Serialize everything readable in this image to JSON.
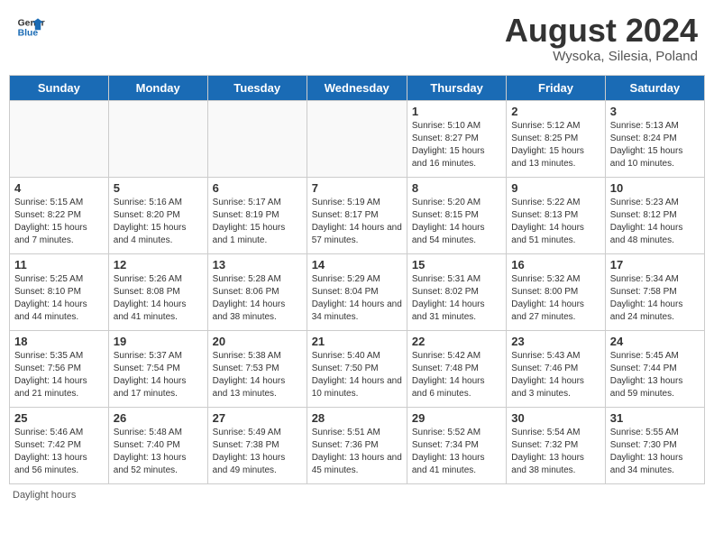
{
  "logo": {
    "line1": "General",
    "line2": "Blue"
  },
  "title": {
    "month_year": "August 2024",
    "location": "Wysoka, Silesia, Poland"
  },
  "days_of_week": [
    "Sunday",
    "Monday",
    "Tuesday",
    "Wednesday",
    "Thursday",
    "Friday",
    "Saturday"
  ],
  "footer": {
    "daylight_label": "Daylight hours"
  },
  "weeks": [
    [
      {
        "day": "",
        "info": ""
      },
      {
        "day": "",
        "info": ""
      },
      {
        "day": "",
        "info": ""
      },
      {
        "day": "",
        "info": ""
      },
      {
        "day": "1",
        "info": "Sunrise: 5:10 AM\nSunset: 8:27 PM\nDaylight: 15 hours and 16 minutes."
      },
      {
        "day": "2",
        "info": "Sunrise: 5:12 AM\nSunset: 8:25 PM\nDaylight: 15 hours and 13 minutes."
      },
      {
        "day": "3",
        "info": "Sunrise: 5:13 AM\nSunset: 8:24 PM\nDaylight: 15 hours and 10 minutes."
      }
    ],
    [
      {
        "day": "4",
        "info": "Sunrise: 5:15 AM\nSunset: 8:22 PM\nDaylight: 15 hours and 7 minutes."
      },
      {
        "day": "5",
        "info": "Sunrise: 5:16 AM\nSunset: 8:20 PM\nDaylight: 15 hours and 4 minutes."
      },
      {
        "day": "6",
        "info": "Sunrise: 5:17 AM\nSunset: 8:19 PM\nDaylight: 15 hours and 1 minute."
      },
      {
        "day": "7",
        "info": "Sunrise: 5:19 AM\nSunset: 8:17 PM\nDaylight: 14 hours and 57 minutes."
      },
      {
        "day": "8",
        "info": "Sunrise: 5:20 AM\nSunset: 8:15 PM\nDaylight: 14 hours and 54 minutes."
      },
      {
        "day": "9",
        "info": "Sunrise: 5:22 AM\nSunset: 8:13 PM\nDaylight: 14 hours and 51 minutes."
      },
      {
        "day": "10",
        "info": "Sunrise: 5:23 AM\nSunset: 8:12 PM\nDaylight: 14 hours and 48 minutes."
      }
    ],
    [
      {
        "day": "11",
        "info": "Sunrise: 5:25 AM\nSunset: 8:10 PM\nDaylight: 14 hours and 44 minutes."
      },
      {
        "day": "12",
        "info": "Sunrise: 5:26 AM\nSunset: 8:08 PM\nDaylight: 14 hours and 41 minutes."
      },
      {
        "day": "13",
        "info": "Sunrise: 5:28 AM\nSunset: 8:06 PM\nDaylight: 14 hours and 38 minutes."
      },
      {
        "day": "14",
        "info": "Sunrise: 5:29 AM\nSunset: 8:04 PM\nDaylight: 14 hours and 34 minutes."
      },
      {
        "day": "15",
        "info": "Sunrise: 5:31 AM\nSunset: 8:02 PM\nDaylight: 14 hours and 31 minutes."
      },
      {
        "day": "16",
        "info": "Sunrise: 5:32 AM\nSunset: 8:00 PM\nDaylight: 14 hours and 27 minutes."
      },
      {
        "day": "17",
        "info": "Sunrise: 5:34 AM\nSunset: 7:58 PM\nDaylight: 14 hours and 24 minutes."
      }
    ],
    [
      {
        "day": "18",
        "info": "Sunrise: 5:35 AM\nSunset: 7:56 PM\nDaylight: 14 hours and 21 minutes."
      },
      {
        "day": "19",
        "info": "Sunrise: 5:37 AM\nSunset: 7:54 PM\nDaylight: 14 hours and 17 minutes."
      },
      {
        "day": "20",
        "info": "Sunrise: 5:38 AM\nSunset: 7:53 PM\nDaylight: 14 hours and 13 minutes."
      },
      {
        "day": "21",
        "info": "Sunrise: 5:40 AM\nSunset: 7:50 PM\nDaylight: 14 hours and 10 minutes."
      },
      {
        "day": "22",
        "info": "Sunrise: 5:42 AM\nSunset: 7:48 PM\nDaylight: 14 hours and 6 minutes."
      },
      {
        "day": "23",
        "info": "Sunrise: 5:43 AM\nSunset: 7:46 PM\nDaylight: 14 hours and 3 minutes."
      },
      {
        "day": "24",
        "info": "Sunrise: 5:45 AM\nSunset: 7:44 PM\nDaylight: 13 hours and 59 minutes."
      }
    ],
    [
      {
        "day": "25",
        "info": "Sunrise: 5:46 AM\nSunset: 7:42 PM\nDaylight: 13 hours and 56 minutes."
      },
      {
        "day": "26",
        "info": "Sunrise: 5:48 AM\nSunset: 7:40 PM\nDaylight: 13 hours and 52 minutes."
      },
      {
        "day": "27",
        "info": "Sunrise: 5:49 AM\nSunset: 7:38 PM\nDaylight: 13 hours and 49 minutes."
      },
      {
        "day": "28",
        "info": "Sunrise: 5:51 AM\nSunset: 7:36 PM\nDaylight: 13 hours and 45 minutes."
      },
      {
        "day": "29",
        "info": "Sunrise: 5:52 AM\nSunset: 7:34 PM\nDaylight: 13 hours and 41 minutes."
      },
      {
        "day": "30",
        "info": "Sunrise: 5:54 AM\nSunset: 7:32 PM\nDaylight: 13 hours and 38 minutes."
      },
      {
        "day": "31",
        "info": "Sunrise: 5:55 AM\nSunset: 7:30 PM\nDaylight: 13 hours and 34 minutes."
      }
    ]
  ]
}
